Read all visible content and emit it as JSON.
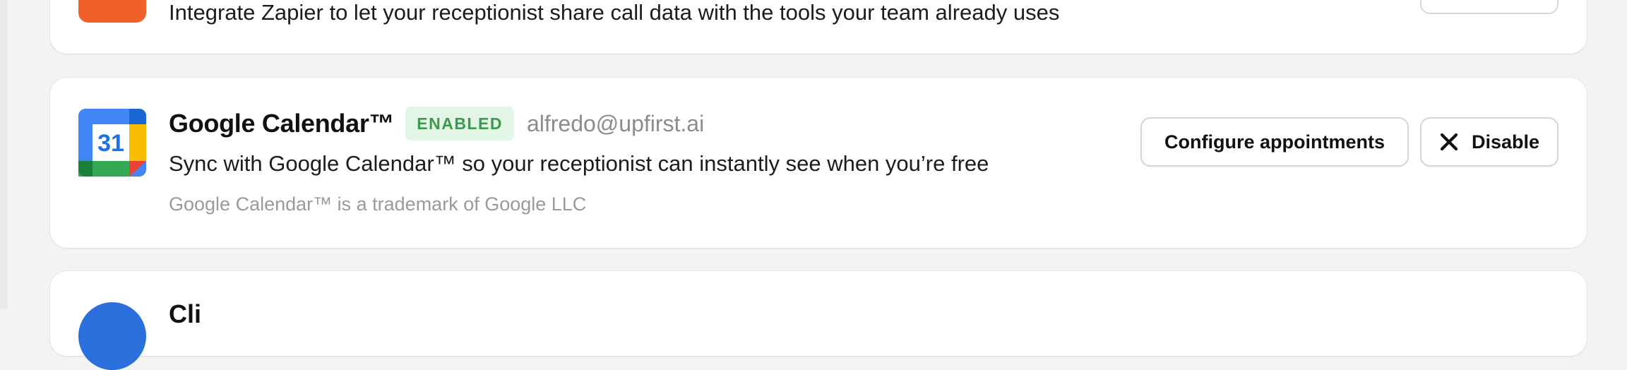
{
  "zapier_card": {
    "description": "Integrate Zapier to let your receptionist share call data with the tools your team already uses"
  },
  "calendar_card": {
    "title": "Google Calendar™",
    "status_badge": "ENABLED",
    "account_email": "alfredo@upfirst.ai",
    "description": "Sync with Google Calendar™ so your receptionist can instantly see when you’re free",
    "trademark_note": "Google Calendar™ is a trademark of Google LLC",
    "logo_day": "31",
    "configure_label": "Configure appointments",
    "disable_label": "Disable"
  },
  "next_card": {
    "title": "Cli"
  },
  "colors": {
    "zapier_orange": "#f15f2a",
    "badge_bg": "#e3f5e6",
    "badge_text": "#3c9a4f",
    "gcal_blue": "#4285f4",
    "gcal_green": "#34a853",
    "gcal_yellow": "#fbbc04",
    "gcal_red": "#ea4335"
  }
}
